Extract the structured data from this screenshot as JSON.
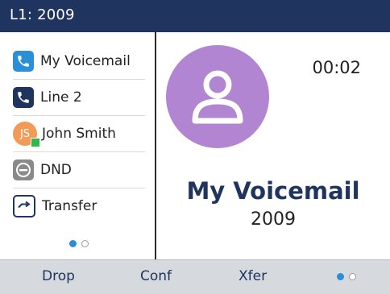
{
  "header": {
    "line_label": "L1: 2009"
  },
  "line_keys": [
    {
      "label": "My Voicemail",
      "icon": "phone-icon"
    },
    {
      "label": "Line 2",
      "icon": "phone-icon"
    },
    {
      "label": "John Smith",
      "icon": "contact-avatar",
      "avatar_initials": "JS",
      "presence": "available"
    },
    {
      "label": "DND",
      "icon": "dnd-icon"
    },
    {
      "label": "Transfer",
      "icon": "transfer-arrow-icon"
    }
  ],
  "call": {
    "timer": "00:02",
    "name": "My Voicemail",
    "number": "2009"
  },
  "softkeys": [
    {
      "label": "Drop"
    },
    {
      "label": "Conf"
    },
    {
      "label": "Xfer"
    }
  ],
  "pagination": {
    "left_page": 1,
    "left_pages": 2,
    "softkey_page": 1,
    "softkey_pages": 2
  },
  "colors": {
    "header_bg": "#1f3560",
    "accent_blue": "#2a8fd6",
    "avatar_purple": "#b185d2",
    "avatar_orange": "#f29a57",
    "presence_green": "#2fb84b",
    "softkey_bar": "#d6d9de"
  }
}
